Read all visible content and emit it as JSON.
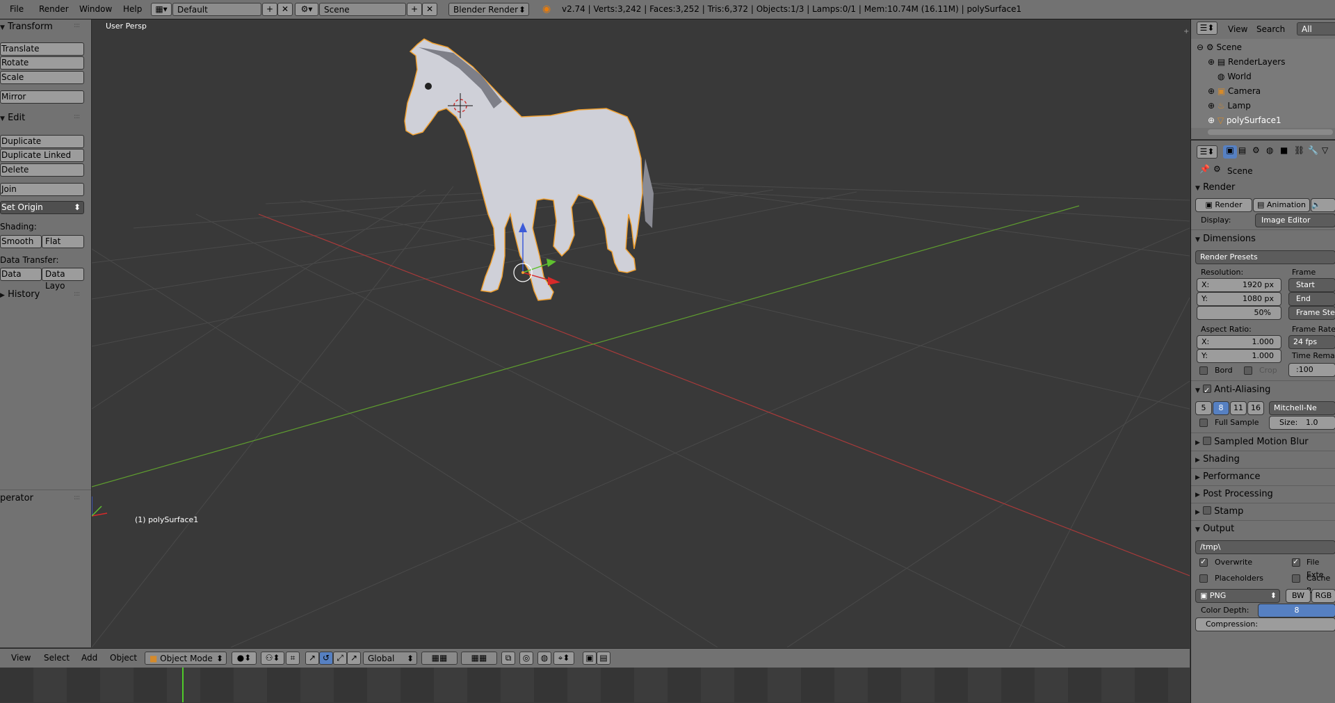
{
  "topbar": {
    "menus": [
      "File",
      "Render",
      "Window",
      "Help"
    ],
    "layout_name": "Default",
    "scene_name": "Scene",
    "engine": "Blender Render",
    "stats": "v2.74 | Verts:3,242 | Faces:3,252 | Tris:6,372 | Objects:1/3 | Lamps:0/1 | Mem:10.74M (16.11M) | polySurface1"
  },
  "toolshelf": {
    "transform_header": "Transform",
    "translate": "Translate",
    "rotate": "Rotate",
    "scale": "Scale",
    "mirror": "Mirror",
    "edit_header": "Edit",
    "duplicate": "Duplicate",
    "duplicate_linked": "Duplicate Linked",
    "delete": "Delete",
    "join": "Join",
    "set_origin": "Set Origin",
    "shading_label": "Shading:",
    "smooth": "Smooth",
    "flat": "Flat",
    "data_transfer_label": "Data Transfer:",
    "data": "Data",
    "data_layout": "Data Layo",
    "history_header": "History",
    "operator_header": "perator"
  },
  "viewport": {
    "view_label": "User Persp",
    "object_label": "(1) polySurface1"
  },
  "view_header": {
    "menus": [
      "View",
      "Select",
      "Add",
      "Object"
    ],
    "mode": "Object Mode",
    "orientation": "Global"
  },
  "outliner": {
    "view": "View",
    "search": "Search",
    "all_scenes": "All Scene",
    "items": [
      "Scene",
      "RenderLayers",
      "World",
      "Camera",
      "Lamp",
      "polySurface1"
    ]
  },
  "properties": {
    "scene_label": "Scene",
    "render_header": "Render",
    "render_btn": "Render",
    "animation_btn": "Animation",
    "display_label": "Display:",
    "display_value": "Image Editor",
    "dimensions_header": "Dimensions",
    "render_presets": "Render Presets",
    "resolution_label": "Resolution:",
    "res_x": "1920 px",
    "res_y": "1080 px",
    "res_pct": "50%",
    "x_label": "X:",
    "y_label": "Y:",
    "frame_range_label": "Frame Rang",
    "start_frame": "Start Fram",
    "end_frame": "End Frame",
    "frame_step": "Frame Ste",
    "aspect_label": "Aspect Ratio:",
    "aspect_x": "1.000",
    "aspect_y": "1.000",
    "frame_rate_label": "Frame Rate",
    "fps": "24 fps",
    "time_remap": "Time Rema",
    "bord": "Bord",
    "crop": "Crop",
    "remap_value": ":100",
    "aa_header": "Anti-Aliasing",
    "aa_samples": [
      "5",
      "8",
      "11",
      "16"
    ],
    "aa_filter": "Mitchell-Ne",
    "full_sample": "Full Sample",
    "size_label": "Size:",
    "size_value": "1.0",
    "motion_blur": "Sampled Motion Blur",
    "shading": "Shading",
    "performance": "Performance",
    "post_processing": "Post Processing",
    "stamp": "Stamp",
    "output_header": "Output",
    "output_path": "/tmp\\",
    "overwrite": "Overwrite",
    "file_extensions": "File Exte",
    "placeholders": "Placeholders",
    "cache_result": "Cache R",
    "format": "PNG",
    "bw": "BW",
    "rgb": "RGB",
    "color_depth_label": "Color Depth:",
    "color_depth": "8",
    "compression_label": "Compression:"
  },
  "colors": {
    "panel": "#727272",
    "viewport_bg": "#393939",
    "x_axis": "#a83a3a",
    "y_axis": "#5f9e2f",
    "selected_outline": "#f0a030",
    "accent_blue": "#5680c2"
  }
}
